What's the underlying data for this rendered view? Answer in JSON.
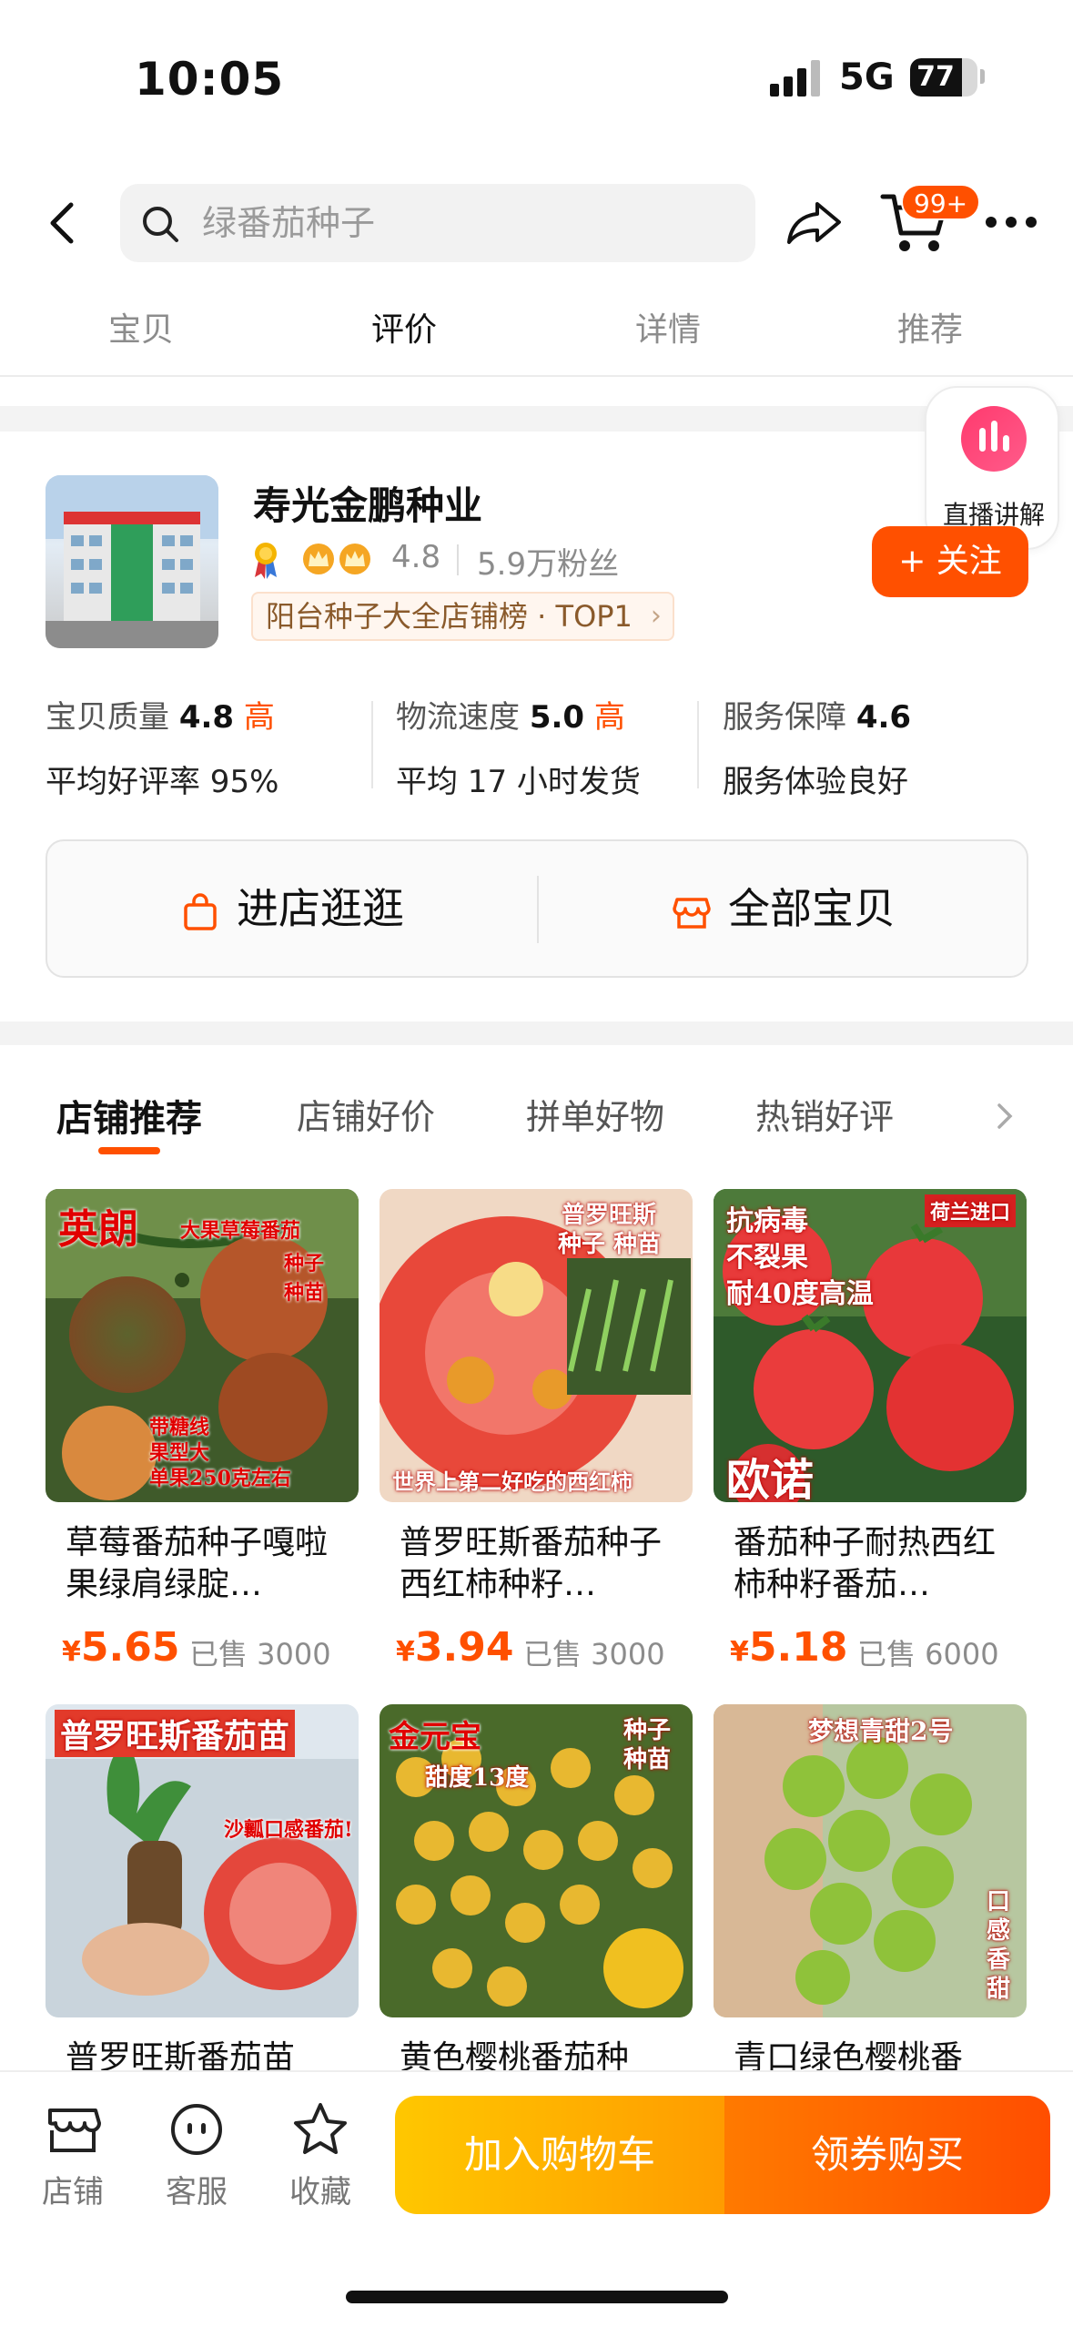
{
  "status_bar": {
    "time": "10:05",
    "network": "5G",
    "battery": "77",
    "battery_level": 0.77
  },
  "top_nav": {
    "search_placeholder": "绿番茄种子",
    "cart_badge": "99+"
  },
  "tabs": [
    "宝贝",
    "评价",
    "详情",
    "推荐"
  ],
  "active_tab": "评价",
  "live_badge": {
    "label": "直播讲解"
  },
  "shop": {
    "name": "寿光金鹏种业",
    "rating": "4.8",
    "fans": "5.9万粉丝",
    "rank_tag": "阳台种子大全店铺榜 · TOP1",
    "follow_label": "+ 关注",
    "metrics": [
      {
        "label": "宝贝质量",
        "score": "4.8",
        "level": "高",
        "sub": "平均好评率 95%"
      },
      {
        "label": "物流速度",
        "score": "5.0",
        "level": "高",
        "sub": "平均 17 小时发货"
      },
      {
        "label": "服务保障",
        "score": "4.6",
        "level": "",
        "sub": "服务体验良好"
      }
    ],
    "enter_store_label": "进店逛逛",
    "all_items_label": "全部宝贝"
  },
  "recommend": {
    "tabs": [
      "店铺推荐",
      "店铺好价",
      "拼单好物",
      "热销好评"
    ],
    "active": "店铺推荐",
    "products": [
      {
        "title": "草莓番茄种子嘎啦果绿肩绿腚…",
        "price": "5.65",
        "sold": "已售 3000",
        "img_text": [
          "英朗",
          "大果草莓番茄",
          "种子",
          "种苗",
          "带糖线",
          "果型大",
          "单果250克左右"
        ]
      },
      {
        "title": "普罗旺斯番茄种子西红柿种籽…",
        "price": "3.94",
        "sold": "已售 3000",
        "img_text": [
          "普罗旺斯",
          "种子 种苗",
          "世界上第二好吃的西红柿"
        ]
      },
      {
        "title": "番茄种子耐热西红柿种籽番茄…",
        "price": "5.18",
        "sold": "已售 6000",
        "img_text": [
          "抗病毒",
          "不裂果",
          "耐40度高温",
          "荷兰进口",
          "欧诺"
        ]
      },
      {
        "title": "普罗旺斯番茄苗",
        "price": "",
        "sold": "",
        "img_text": [
          "普罗旺斯番茄苗",
          "沙瓤口感番茄!"
        ]
      },
      {
        "title": "黄色樱桃番茄种",
        "price": "",
        "sold": "",
        "img_text": [
          "金元宝",
          "甜度13度",
          "种子",
          "种苗"
        ]
      },
      {
        "title": "青口绿色樱桃番",
        "price": "",
        "sold": "",
        "img_text": [
          "梦想青甜2号",
          "口",
          "感",
          "香",
          "甜"
        ]
      }
    ]
  },
  "bottom_bar": {
    "shop": "店铺",
    "service": "客服",
    "favorite": "收藏",
    "add_cart": "加入购物车",
    "buy": "领券购买"
  },
  "currency": "¥",
  "colors": {
    "accent": "#ff5000",
    "cart_gradient_start": "#ffc700",
    "buy_gradient_end": "#ff4e00"
  }
}
